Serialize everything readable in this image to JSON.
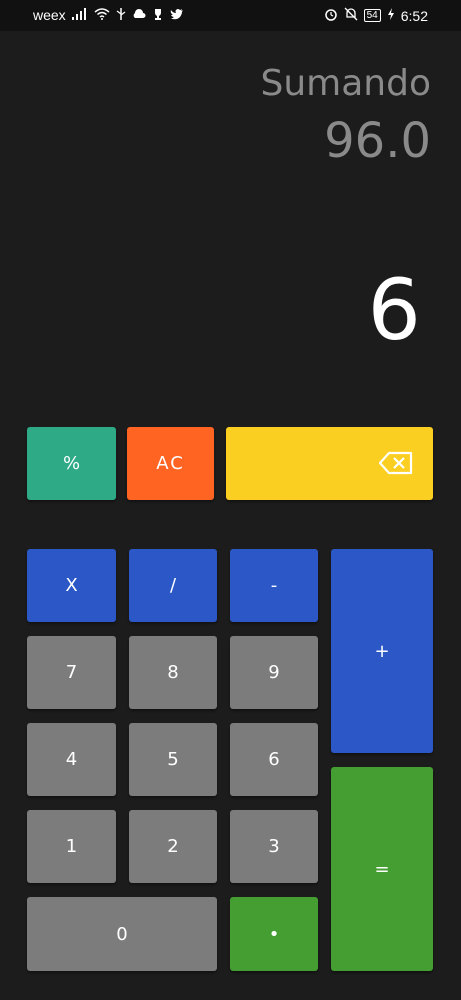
{
  "status_bar": {
    "carrier": "weex",
    "battery": "54",
    "time": "6:52"
  },
  "display": {
    "operation": "Sumando",
    "previous_value": "96.0",
    "current_value": "6"
  },
  "buttons": {
    "percent": "%",
    "clear": "AC",
    "multiply": "X",
    "divide": "/",
    "subtract": "-",
    "add": "+",
    "equals": "=",
    "dot": "•",
    "seven": "7",
    "eight": "8",
    "nine": "9",
    "four": "4",
    "five": "5",
    "six": "6",
    "one": "1",
    "two": "2",
    "three": "3",
    "zero": "0"
  },
  "colors": {
    "background": "#1c1c1c",
    "percent": "#2eaa86",
    "clear": "#ff6423",
    "backspace": "#fbcf21",
    "operators": "#2b57c7",
    "digits": "#7c7c7c",
    "equals_and_dot": "#449e31"
  },
  "icons": {
    "backspace": "backspace-icon"
  }
}
